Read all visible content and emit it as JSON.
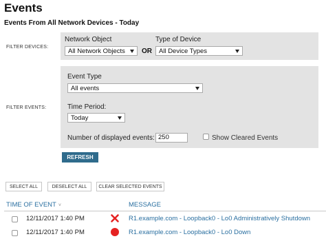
{
  "header": {
    "title": "Events",
    "section_title": "Events From All Network Devices - Today"
  },
  "filter_devices": {
    "row_label": "FILTER DEVICES:",
    "network_object_label": "Network Object",
    "network_object_value": "All Network Objects",
    "or_label": "OR",
    "device_type_label": "Type of Device",
    "device_type_value": "All Device Types"
  },
  "filter_events": {
    "row_label": "FILTER EVENTS:",
    "event_type_label": "Event Type",
    "event_type_value": "All events",
    "time_period_label": "Time Period:",
    "time_period_value": "Today",
    "num_events_label": "Number of displayed events:",
    "num_events_value": "250",
    "show_cleared_label": "Show Cleared Events",
    "show_cleared_checked": false
  },
  "buttons": {
    "refresh": "REFRESH",
    "select_all": "SELECT ALL",
    "deselect_all": "DESELECT ALL",
    "clear_selected": "CLEAR SELECTED EVENTS"
  },
  "table": {
    "col_time": "TIME OF EVENT",
    "col_time_sort": "˅",
    "col_message": "MESSAGE",
    "rows": [
      {
        "time": "12/11/2017 1:40 PM",
        "severity": "x-icon",
        "severity_color": "#e52222",
        "message": "R1.example.com - Loopback0 - Lo0 Administratively Shutdown"
      },
      {
        "time": "12/11/2017 1:40 PM",
        "severity": "red-dot-icon",
        "severity_color": "#e52222",
        "message": "R1.example.com - Loopback0 - Lo0 Down"
      }
    ]
  },
  "colors": {
    "accent_button": "#2f6b8c",
    "link": "#2a6fa0",
    "filter_background": "#e3e3e3"
  }
}
